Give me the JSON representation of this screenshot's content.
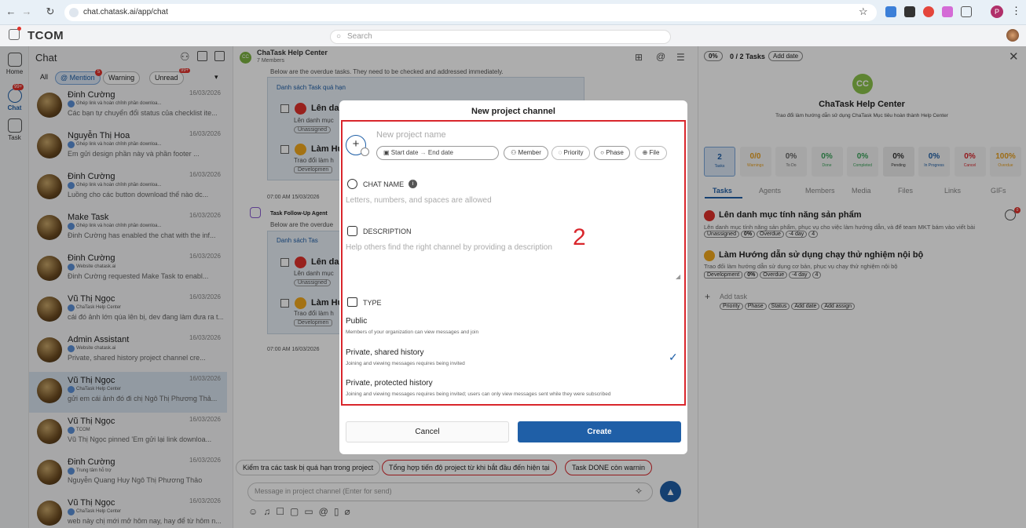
{
  "browser": {
    "url": "chat.chatask.ai/app/chat"
  },
  "app": {
    "brand": "TCOM",
    "search_placeholder": "Search"
  },
  "rail": {
    "home": "Home",
    "chat": "Chat",
    "task": "Task",
    "chat_badge": "99+"
  },
  "chat_list": {
    "title": "Chat",
    "filters": [
      {
        "label": "All"
      },
      {
        "label": "@ Mention",
        "badge": "5"
      },
      {
        "label": "Warning"
      },
      {
        "label": "Unread",
        "badge": "99+"
      }
    ],
    "items": [
      {
        "name": "Đinh Cường",
        "date": "16/03/2026",
        "sub": "Ghép link và hoàn chỉnh phần downloa...",
        "msg": "Các bạn tự chuyển đổi status của checklist ite..."
      },
      {
        "name": "Nguyễn Thị Hoa",
        "date": "16/03/2026",
        "sub": "Ghép link và hoàn chỉnh phần downloa...",
        "msg": "Em gửi design phần này và phần footer ..."
      },
      {
        "name": "Đinh Cường",
        "date": "16/03/2026",
        "sub": "Ghép link và hoàn chỉnh phần downloa...",
        "msg": "Luồng cho các button download thế nào dc..."
      },
      {
        "name": "Make Task",
        "date": "16/03/2026",
        "sub": "Ghép link và hoàn chỉnh phần downloa...",
        "msg": "Đinh Cường has enabled the chat with the inf..."
      },
      {
        "name": "Đinh Cường",
        "date": "16/03/2026",
        "sub": "Website chatask.ai",
        "msg": "Đinh Cường requested Make Task to enabl..."
      },
      {
        "name": "Vũ Thị Ngọc",
        "date": "16/03/2026",
        "sub": "ChaTask Help Center",
        "msg": "cái đó ảnh lớn qúa lên bị, dev đang làm đưa ra t..."
      },
      {
        "name": "Admin Assistant",
        "date": "16/03/2026",
        "sub": "Website chatask.ai",
        "msg": "Private, shared history project channel cre..."
      },
      {
        "name": "Vũ Thị Ngọc",
        "date": "16/03/2026",
        "sub": "ChaTask Help Center",
        "msg": "gửi em cái ảnh đó đi chị Ngô Thị Phương Thả..."
      },
      {
        "name": "Vũ Thị Ngọc",
        "date": "16/03/2026",
        "sub": "TCOM",
        "msg": "Vũ Thị Ngọc pinned 'Em gửi lại link downloa..."
      },
      {
        "name": "Đinh Cường",
        "date": "16/03/2026",
        "sub": "Trung tâm hỗ trợ",
        "msg": "Nguyễn Quang Huy Ngô Thị Phương Thảo"
      },
      {
        "name": "Vũ Thị Ngọc",
        "date": "16/03/2026",
        "sub": "ChaTask Help Center",
        "msg": "web này chị mới mở hôm nay, hay để từ hôm n..."
      }
    ]
  },
  "conversation": {
    "title": "ChaTask Help Center",
    "members": "7 Members",
    "line1": "Below are the overdue tasks. They need to be checked and addressed immediately.",
    "list_title": "Danh sách Task quá hạn",
    "task1": "Lên dan",
    "task1_desc": "Lên danh mục",
    "unassigned": "Unassigned",
    "task2": "Làm Hu",
    "task2_desc": "Trao đổi làm h",
    "dev": "Developmen",
    "time1": "07:00 AM 15/03/2026",
    "agent": "Task Follow-Up Agent",
    "line2": "Below are the overdue",
    "list_title2": "Danh sách Tas",
    "time2": "07:00 AM 16/03/2026",
    "quick": [
      "Kiểm tra các task bị quá hạn trong project",
      "Tổng hợp tiến độ project từ khi bắt đầu đến hiện tại",
      "Task DONE còn warnin"
    ],
    "composer_placeholder": "Message in project channel (Enter for send)"
  },
  "right": {
    "progress": "0%",
    "task_count": "0 / 2 Tasks",
    "add_date": "Add date",
    "avatar": "CC",
    "title": "ChaTask Help Center",
    "desc": "Trao đổi làm hướng dẫn sử dụng ChaTask Mục tiêu hoàn thành Help Center",
    "stats": [
      {
        "v": "2",
        "l": "Tasks"
      },
      {
        "v": "0/0",
        "l": "Warnings"
      },
      {
        "v": "0%",
        "l": "To Do"
      },
      {
        "v": "0%",
        "l": "Done"
      },
      {
        "v": "0%",
        "l": "Completed"
      },
      {
        "v": "0%",
        "l": "Pending"
      },
      {
        "v": "0%",
        "l": "In Progress"
      },
      {
        "v": "0%",
        "l": "Cancel"
      },
      {
        "v": "100%",
        "l": "Overdue"
      }
    ],
    "tabs": [
      "Tasks",
      "Agents",
      "Members",
      "Media",
      "Files",
      "Links",
      "GIFs"
    ],
    "task1": {
      "title": "Lên danh mục tính năng sản phẩm",
      "desc": "Lên danh mục tính năng sản phẩm, phục vụ cho việc làm hướng dẫn, và để team MKT bám vào viết bài",
      "tags": [
        "Unassigned",
        "0%",
        "Overdue",
        "-4 day",
        "4"
      ]
    },
    "task2": {
      "title": "Làm Hướng dẫn sử dụng chạy thử nghiệm nội bộ",
      "desc": "Trao đổi làm hướng dẫn sử dụng cơ bản, phục vụ chạy thử nghiệm nội bộ",
      "tags": [
        "Development",
        "0%",
        "Overdue",
        "-4 day",
        "4"
      ]
    },
    "add_task": "Add task",
    "add_tags": [
      "Priority",
      "Phase",
      "Status",
      "Add date",
      "Add assign"
    ],
    "comment_badge": "0"
  },
  "modal": {
    "title": "New project channel",
    "name_placeholder": "New project name",
    "start": "Start date",
    "end": "End date",
    "pills": [
      "Member",
      "Priority",
      "Phase",
      "File"
    ],
    "chat_name_label": "CHAT NAME",
    "chat_name_placeholder": "Letters, numbers, and spaces are allowed",
    "desc_label": "DESCRIPTION",
    "desc_placeholder": "Help others find the right channel by providing a description",
    "type_label": "TYPE",
    "options": [
      {
        "title": "Public",
        "desc": "Members of your organization can view messages and join"
      },
      {
        "title": "Private, shared history",
        "desc": "Joining and viewing messages requires being invited"
      },
      {
        "title": "Private, protected history",
        "desc": "Joining and viewing messages requires being invited; users can only view messages sent while they were subscribed"
      }
    ],
    "selected": "Private, shared history",
    "annotation": "2",
    "cancel": "Cancel",
    "create": "Create"
  },
  "colors": {
    "accent": "#1f5fa7",
    "annotation": "#d9262c",
    "selected_row": "#d8e3ef"
  }
}
